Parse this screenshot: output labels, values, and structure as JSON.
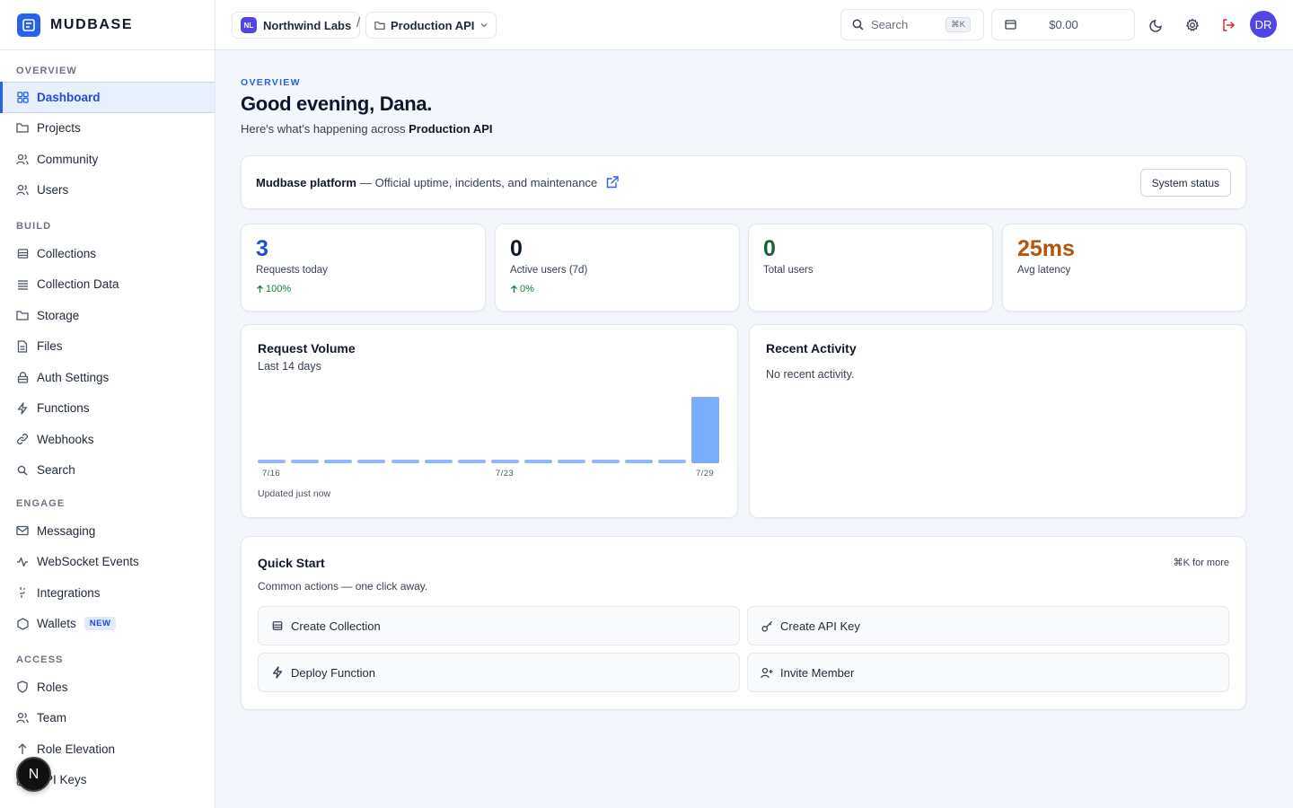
{
  "app": {
    "name": "MUDBASE"
  },
  "sidebar": {
    "sections": [
      {
        "title": "OVERVIEW",
        "items": [
          {
            "label": "Dashboard",
            "icon": "grid-icon",
            "active": true
          },
          {
            "label": "Projects",
            "icon": "folder-icon"
          },
          {
            "label": "Community",
            "icon": "users-icon"
          },
          {
            "label": "Users",
            "icon": "users-icon"
          }
        ]
      },
      {
        "title": "BUILD",
        "items": [
          {
            "label": "Collections",
            "icon": "database-icon"
          },
          {
            "label": "Collection Data",
            "icon": "rows-icon"
          },
          {
            "label": "Storage",
            "icon": "folder-icon"
          },
          {
            "label": "Files",
            "icon": "file-icon"
          },
          {
            "label": "Auth Settings",
            "icon": "lock-icon"
          },
          {
            "label": "Functions",
            "icon": "bolt-icon"
          },
          {
            "label": "Webhooks",
            "icon": "link-icon"
          },
          {
            "label": "Search",
            "icon": "search-icon"
          }
        ]
      },
      {
        "title": "ENGAGE",
        "items": [
          {
            "label": "Messaging",
            "icon": "mail-icon"
          },
          {
            "label": "WebSocket Events",
            "icon": "activity-icon"
          },
          {
            "label": "Integrations",
            "icon": "plug-icon"
          },
          {
            "label": "Wallets",
            "icon": "hexagon-icon",
            "badge": "NEW"
          }
        ]
      },
      {
        "title": "ACCESS",
        "items": [
          {
            "label": "Roles",
            "icon": "shield-icon"
          },
          {
            "label": "Team",
            "icon": "users-icon"
          },
          {
            "label": "Role Elevation",
            "icon": "arrow-up-icon"
          },
          {
            "label": "API Keys",
            "icon": "key-icon"
          }
        ]
      }
    ],
    "floating_avatar": "N"
  },
  "topbar": {
    "org": {
      "initials": "NL",
      "name": "Northwind Labs"
    },
    "separator": "/",
    "project": "Production API",
    "search": {
      "placeholder": "Search",
      "shortcut": "⌘K"
    },
    "credits": "$0.00",
    "user_initials": "DR"
  },
  "main": {
    "eyebrow": "OVERVIEW",
    "greeting": "Good evening, Dana.",
    "subtitle_prefix": "Here's what's happening across",
    "subtitle_project": "Production API",
    "status_banner": {
      "title": "Mudbase platform",
      "text": "— Official uptime, incidents, and maintenance",
      "button": "System status"
    },
    "stats": [
      {
        "value": "3",
        "label": "Requests today",
        "delta": "100%",
        "color": "#1d4ed8"
      },
      {
        "value": "0",
        "label": "Active users (7d)",
        "delta": "0%",
        "color": "#0f172a"
      },
      {
        "value": "0",
        "label": "Total users",
        "delta": "",
        "color": "#166534"
      },
      {
        "value": "25ms",
        "label": "Avg latency",
        "delta": "",
        "color": "#b45309"
      }
    ],
    "request_volume": {
      "title": "Request Volume",
      "subtitle": "Last 14 days",
      "updated": "Updated just now"
    },
    "recent_activity": {
      "title": "Recent Activity",
      "empty": "No recent activity."
    },
    "quick_start": {
      "title": "Quick Start",
      "hint": "⌘K for more",
      "subtitle": "Common actions — one click away.",
      "actions": [
        {
          "label": "Create Collection",
          "icon": "database-icon"
        },
        {
          "label": "Create API Key",
          "icon": "key-icon"
        },
        {
          "label": "Deploy Function",
          "icon": "bolt-icon"
        },
        {
          "label": "Invite Member",
          "icon": "user-plus-icon"
        }
      ]
    }
  },
  "chart_data": {
    "type": "bar",
    "categories": [
      "7/16",
      "7/17",
      "7/18",
      "7/19",
      "7/20",
      "7/21",
      "7/22",
      "7/23",
      "7/24",
      "7/25",
      "7/26",
      "7/27",
      "7/28",
      "7/29"
    ],
    "values": [
      0,
      0,
      0,
      0,
      0,
      0,
      0,
      0,
      0,
      0,
      0,
      0,
      0,
      3
    ],
    "tick_labels": [
      "7/16",
      "7/23",
      "7/29"
    ],
    "title": "Request Volume",
    "subtitle": "Last 14 days",
    "ylim": [
      0,
      3
    ],
    "grid": false,
    "bar_color": "#93b7fb"
  }
}
